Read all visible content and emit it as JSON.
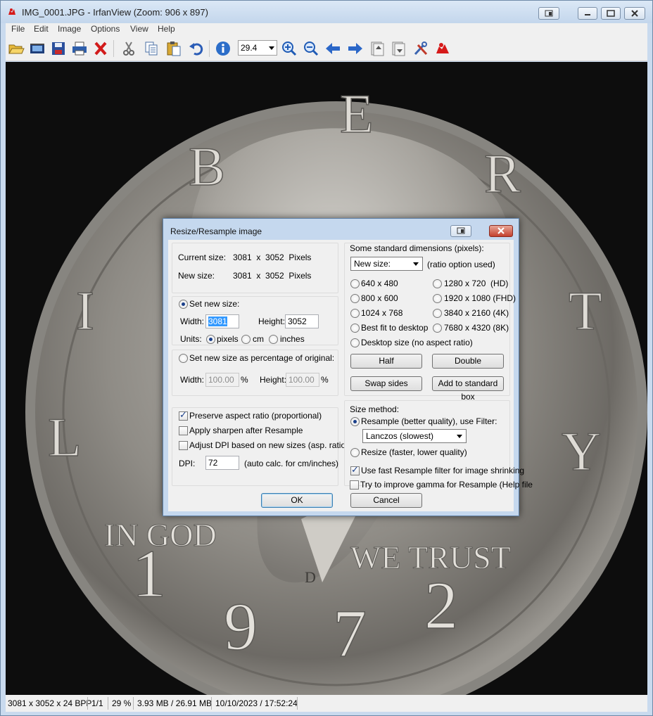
{
  "window": {
    "title": "IMG_0001.JPG - IrfanView (Zoom: 906 x 897)"
  },
  "menu": [
    "File",
    "Edit",
    "Image",
    "Options",
    "View",
    "Help"
  ],
  "toolbar": {
    "zoom_value": "29.4",
    "icons": [
      "open-folder-icon",
      "slideshow-icon",
      "save-icon",
      "print-icon",
      "delete-icon",
      "cut-icon",
      "copy-icon",
      "paste-icon",
      "undo-icon",
      "info-icon",
      "zoom-in-icon",
      "zoom-out-icon",
      "previous-icon",
      "next-icon",
      "page-up-icon",
      "page-down-icon",
      "settings-icon",
      "irfanview-icon"
    ]
  },
  "coin": {
    "legend_top": "LIBERTY",
    "motto_left": "IN GOD",
    "motto_right": "WE TRUST",
    "year": "1972",
    "mint_mark": "D"
  },
  "status": {
    "dimensions": "3081 x 3052 x 24 BPP",
    "page": "1/1",
    "zoom": "29 %",
    "size": "3.93 MB / 26.91 MB",
    "date": "10/10/2023 / 17:52:24"
  },
  "dialog": {
    "title": "Resize/Resample image",
    "current_size_label": "Current size:",
    "current_size_value": "3081  x  3052  Pixels",
    "new_size_label": "New size:",
    "new_size_value": "3081  x  3052  Pixels",
    "set_new_size_label": "Set new size:",
    "width_label": "Width:",
    "width_value": "3081",
    "height_label": "Height:",
    "height_value": "3052",
    "units_label": "Units:",
    "units": [
      "pixels",
      "cm",
      "inches"
    ],
    "percent_label": "Set new size as percentage of original:",
    "pct_width_label": "Width:",
    "pct_width_value": "100.00",
    "pct_height_label": "Height:",
    "pct_height_value": "100.00",
    "pct_symbol": "%",
    "preserve_aspect": "Preserve aspect ratio (proportional)",
    "apply_sharpen": "Apply sharpen after Resample",
    "adjust_dpi": "Adjust DPI based on new sizes (asp. ratio)",
    "dpi_label": "DPI:",
    "dpi_value": "72",
    "dpi_note": "(auto calc. for cm/inches)",
    "std_dims_label": "Some standard dimensions (pixels):",
    "new_size_combo": "New size:",
    "ratio_note": "(ratio option used)",
    "std_options_left": [
      "640 x 480",
      "800 x 600",
      "1024 x 768",
      "Best fit to desktop"
    ],
    "std_options_right": [
      "1280 x 720  (HD)",
      "1920 x 1080 (FHD)",
      "3840 x 2160 (4K)",
      "7680 x 4320 (8K)"
    ],
    "desktop_size": "Desktop size (no aspect ratio)",
    "half_btn": "Half",
    "double_btn": "Double",
    "swap_btn": "Swap sides",
    "add_std_btn": "Add to standard box",
    "size_method_label": "Size method:",
    "resample_label": "Resample (better quality), use Filter:",
    "filter_value": "Lanczos (slowest)",
    "resize_label": "Resize (faster, lower quality)",
    "fast_resample": "Use fast Resample filter for image shrinking",
    "improve_gamma": "Try to improve gamma for Resample (Help file",
    "ok_btn": "OK",
    "cancel_btn": "Cancel"
  }
}
